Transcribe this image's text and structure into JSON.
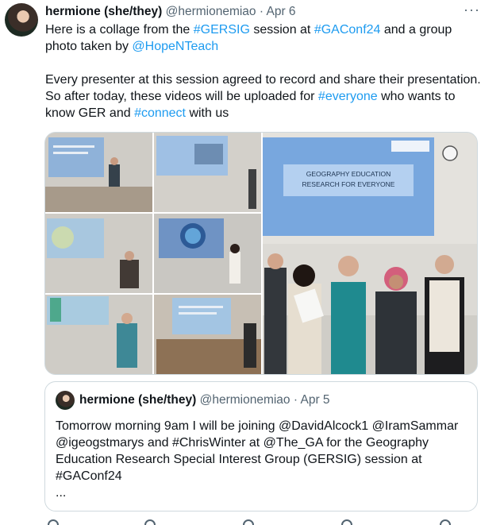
{
  "author": {
    "name": "hermione (she/they)",
    "handle": "@hermionemiao",
    "separator": "·",
    "date": "Apr 6"
  },
  "more_label": "···",
  "body": {
    "p1": [
      {
        "text": "Here is a collage from the ",
        "link": false
      },
      {
        "text": "#GERSIG",
        "link": true
      },
      {
        "text": " session at ",
        "link": false
      },
      {
        "text": "#GAConf24",
        "link": true
      },
      {
        "text": " and a group photo taken by ",
        "link": false
      },
      {
        "text": "@HopeNTeach",
        "link": true
      }
    ],
    "p2": [
      {
        "text": "Every presenter at this session agreed to record and share their presentation. So after today, these videos will be uploaded for ",
        "link": false
      },
      {
        "text": "#everyone",
        "link": true
      },
      {
        "text": " who wants to know GER and ",
        "link": false
      },
      {
        "text": "#connect",
        "link": true
      },
      {
        "text": " with us",
        "link": false
      }
    ]
  },
  "media": {
    "slide_line1": "GEOGRAPHY EDUCATION",
    "slide_line2": "RESEARCH FOR EVERYONE",
    "slide_logo": "The Geographical Association"
  },
  "quote": {
    "name": "hermione (she/they)",
    "handle": "@hermionemiao",
    "separator": "·",
    "date": "Apr 5",
    "text_lines": [
      "Tomorrow morning 9am I will be joining @DavidAlcock1 @IramSammar",
      "@igeogstmarys and #ChrisWinter at @The_GA for the Geography",
      "Education Research Special Interest Group (GERSIG) session at",
      "#GAConf24",
      "..."
    ]
  },
  "colors": {
    "link": "#1d9bf0",
    "secondary_text": "#536471",
    "border": "#cfd9de"
  }
}
